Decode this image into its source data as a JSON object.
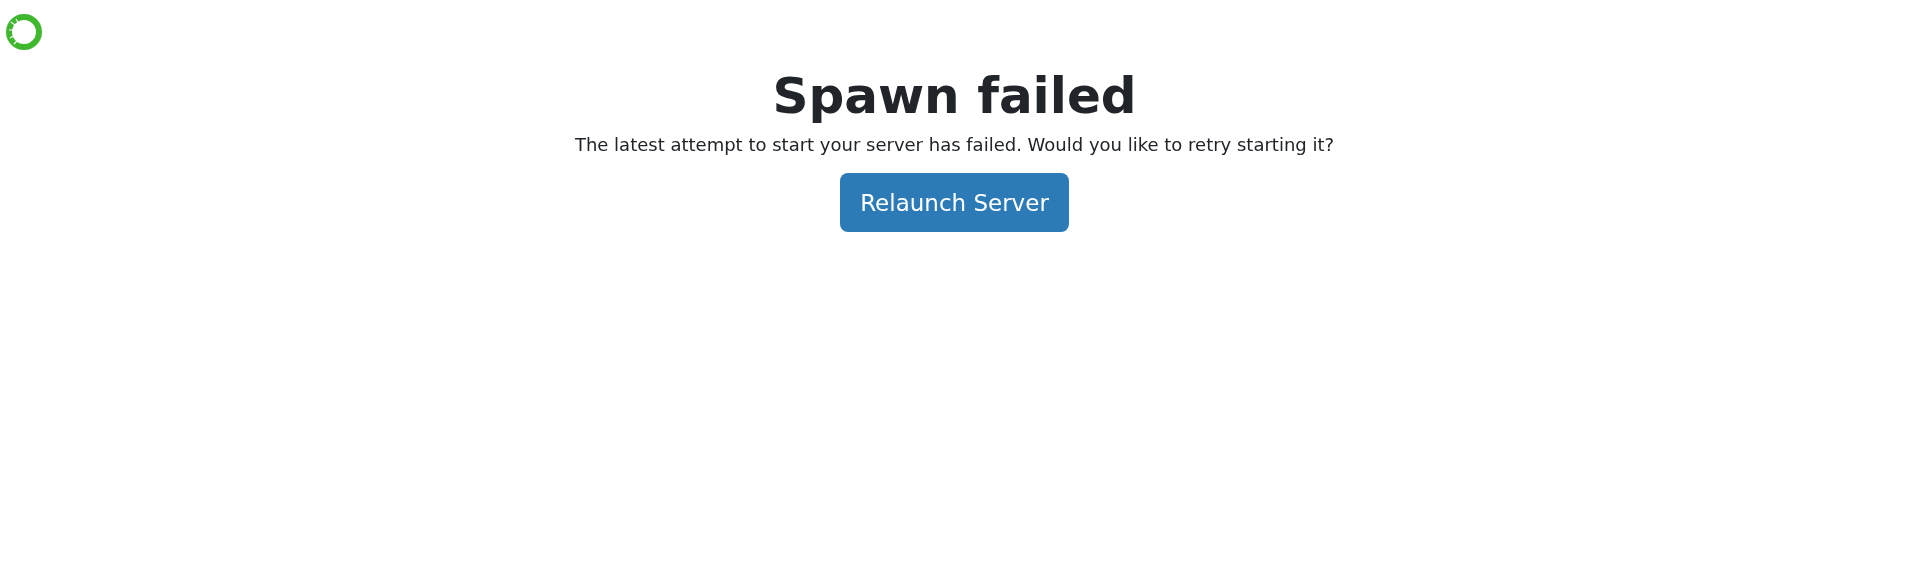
{
  "title": "Spawn failed",
  "message": "The latest attempt to start your server has failed. Would you like to retry starting it?",
  "button": {
    "label": "Relaunch Server"
  }
}
